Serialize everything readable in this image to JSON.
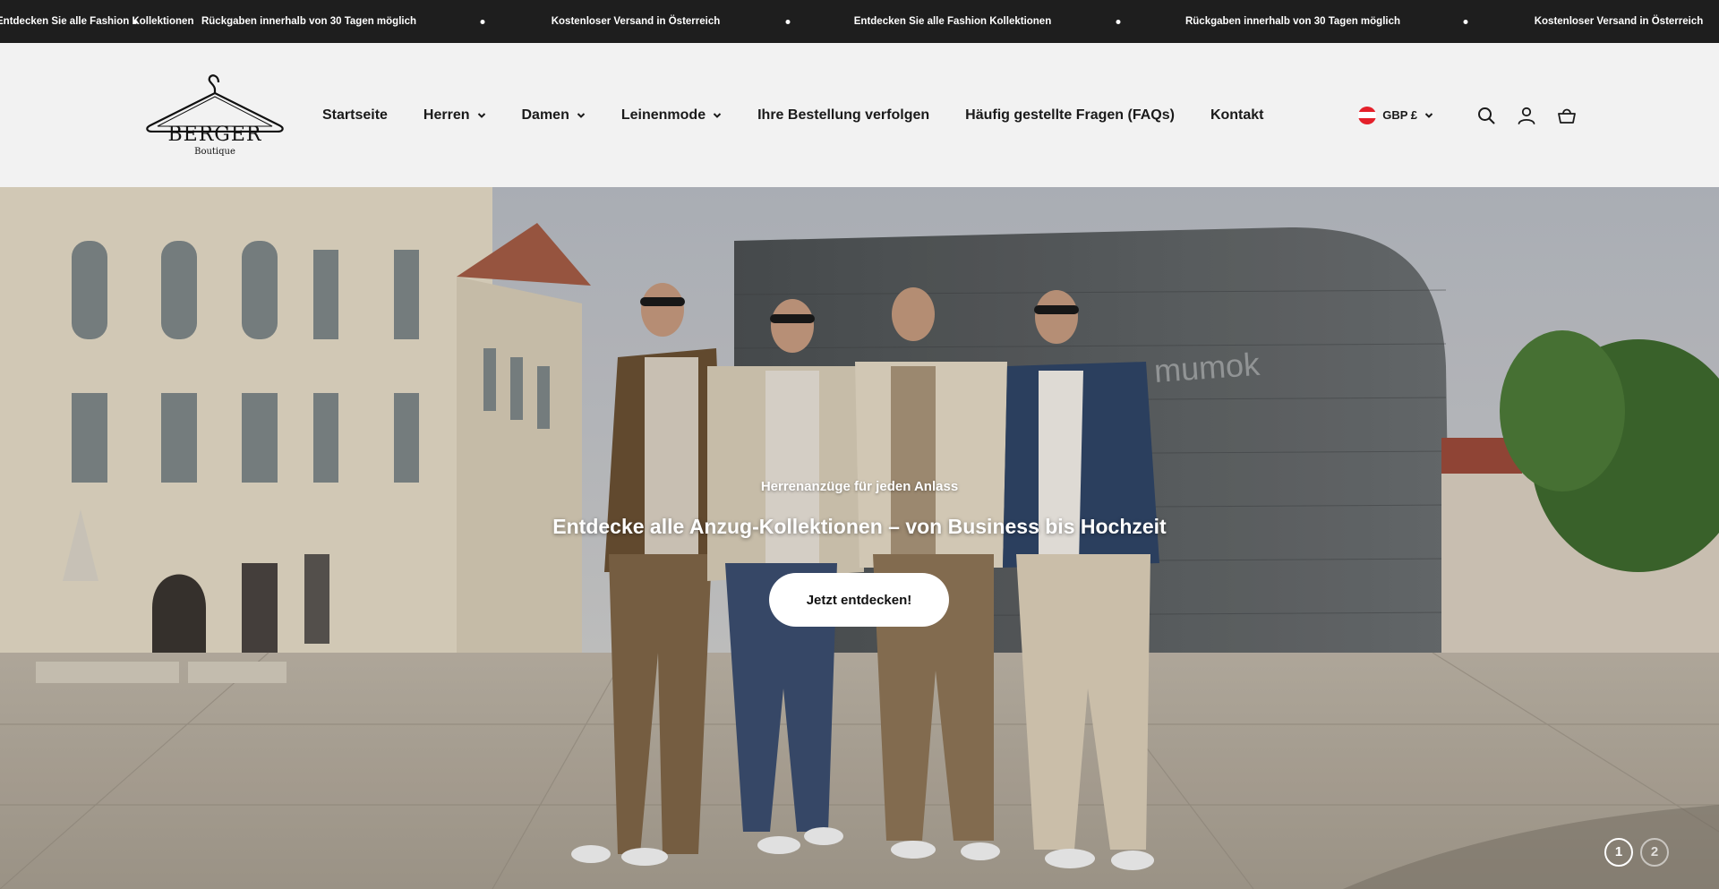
{
  "announcements": [
    "Entdecken Sie alle Fashion Kollektionen",
    "Rückgaben innerhalb von 30 Tagen möglich",
    "Kostenloser Versand in Österreich",
    "Entdecken Sie alle Fashion Kollektionen",
    "Rückgaben innerhalb von 30 Tagen möglich",
    "Kostenloser Versand in Österreich"
  ],
  "logo": {
    "name": "BERGER",
    "sub": "Boutique"
  },
  "nav": {
    "items": [
      {
        "label": "Startseite",
        "has_dropdown": false
      },
      {
        "label": "Herren",
        "has_dropdown": true
      },
      {
        "label": "Damen",
        "has_dropdown": true
      },
      {
        "label": "Leinenmode",
        "has_dropdown": true
      },
      {
        "label": "Ihre Bestellung verfolgen",
        "has_dropdown": false
      },
      {
        "label": "Häufig gestellte Fragen (FAQs)",
        "has_dropdown": false
      },
      {
        "label": "Kontakt",
        "has_dropdown": false
      }
    ]
  },
  "header": {
    "currency": "GBP £",
    "icons": [
      "search-icon",
      "account-icon",
      "cart-icon"
    ]
  },
  "hero": {
    "subtitle": "Herrenanzüge für jeden Anlass",
    "title": "Entdecke alle Anzug-Kollektionen – von Business bis Hochzeit",
    "button": "Jetzt entdecken!",
    "building_sign": "mumok",
    "slides": [
      "1",
      "2"
    ],
    "active_slide": "1"
  },
  "colors": {
    "announcement_bg": "#1e1e1e",
    "header_bg": "#f2f2f2",
    "text": "#1a1a1a",
    "button_bg": "#ffffff"
  }
}
